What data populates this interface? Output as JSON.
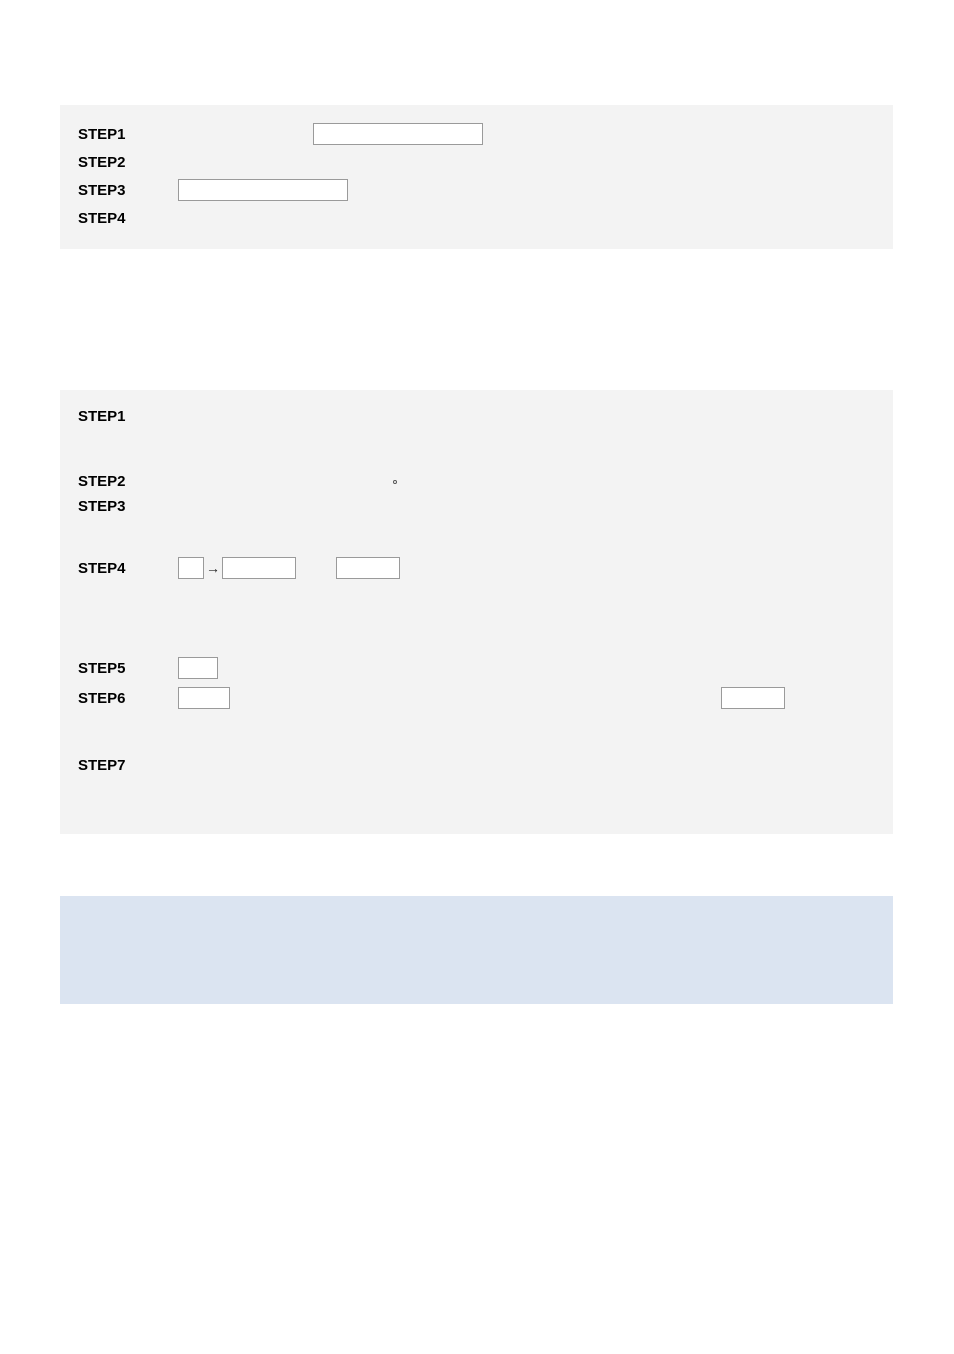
{
  "block1": {
    "steps": [
      "STEP1",
      "STEP2",
      "STEP3",
      "STEP4"
    ]
  },
  "block2": {
    "steps": [
      "STEP1",
      "STEP2",
      "STEP3",
      "STEP4",
      "STEP5",
      "STEP6",
      "STEP7"
    ],
    "arrow_glyph": "→"
  }
}
